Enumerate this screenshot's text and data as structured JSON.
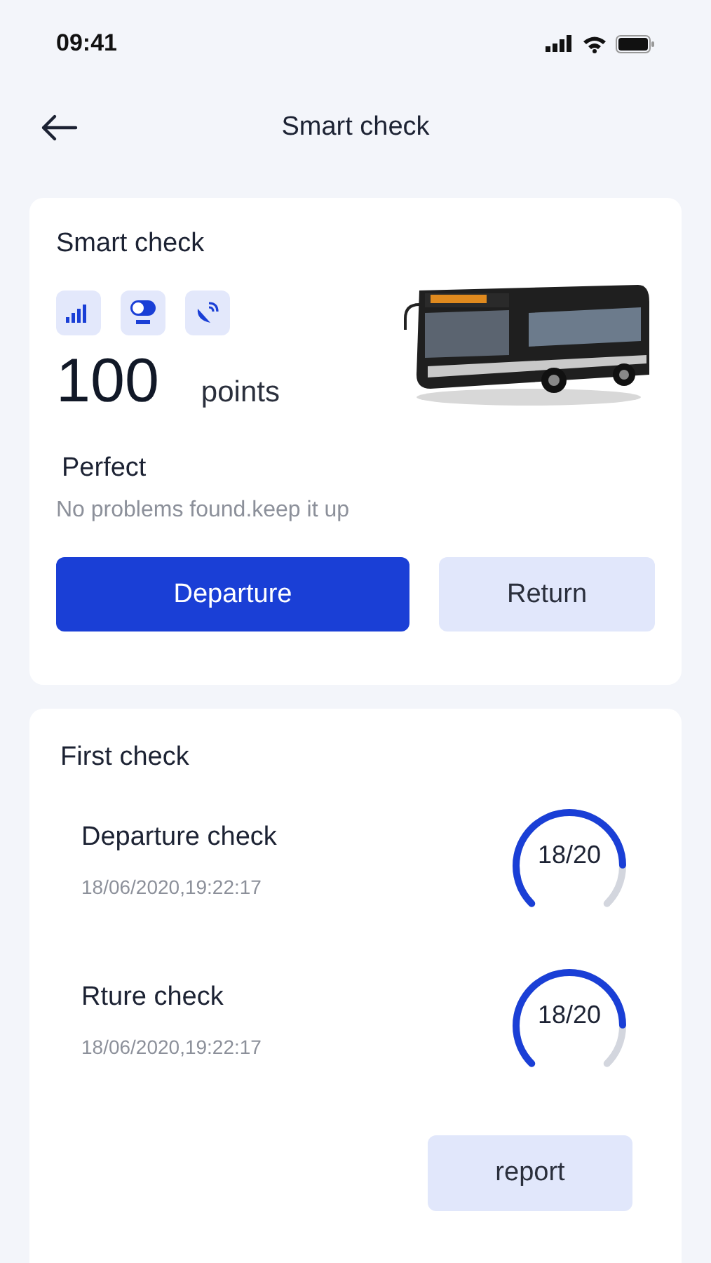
{
  "status_bar": {
    "time": "09:41"
  },
  "header": {
    "title": "Smart check"
  },
  "smart_card": {
    "title": "Smart check",
    "score": "100",
    "unit": "points",
    "status": "Perfect",
    "message": "No problems found.keep it up",
    "buttons": [
      {
        "label": "Departure",
        "selected": true
      },
      {
        "label": "Return",
        "selected": false
      }
    ]
  },
  "first_check": {
    "title": "First check",
    "items": [
      {
        "name": "Departure check",
        "time": "18/06/2020,19:22:17",
        "reading": "18/20",
        "level": 0.83
      },
      {
        "name": "Rture check",
        "time": "18/06/2020,19:22:17",
        "reading": "18/20",
        "level": 0.83
      }
    ],
    "report_button": "report"
  }
}
